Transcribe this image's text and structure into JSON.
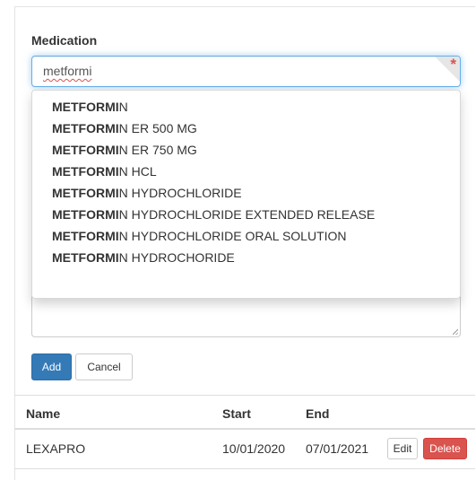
{
  "form": {
    "medication_label": "Medication",
    "medication_value": "metformi",
    "required_marker": "*",
    "add_label": "Add",
    "cancel_label": "Cancel"
  },
  "suggestions": [
    {
      "match": "METFORMI",
      "rest": "N"
    },
    {
      "match": "METFORMI",
      "rest": "N ER 500 MG"
    },
    {
      "match": "METFORMI",
      "rest": "N ER 750 MG"
    },
    {
      "match": "METFORMI",
      "rest": "N HCL"
    },
    {
      "match": "METFORMI",
      "rest": "N HYDROCHLORIDE"
    },
    {
      "match": "METFORMI",
      "rest": "N HYDROCHLORIDE EXTENDED RELEASE"
    },
    {
      "match": "METFORMI",
      "rest": "N HYDROCHLORIDE ORAL SOLUTION"
    },
    {
      "match": "METFORMI",
      "rest": "N HYDROCHORIDE"
    }
  ],
  "table": {
    "headers": {
      "name": "Name",
      "start": "Start",
      "end": "End"
    },
    "rows": [
      {
        "name": "LEXAPRO",
        "start": "10/01/2020",
        "end": "07/01/2021",
        "edit_label": "Edit",
        "delete_label": "Delete"
      }
    ]
  },
  "colors": {
    "primary": "#337ab7",
    "danger": "#d9534f",
    "focus": "#66afe9"
  }
}
